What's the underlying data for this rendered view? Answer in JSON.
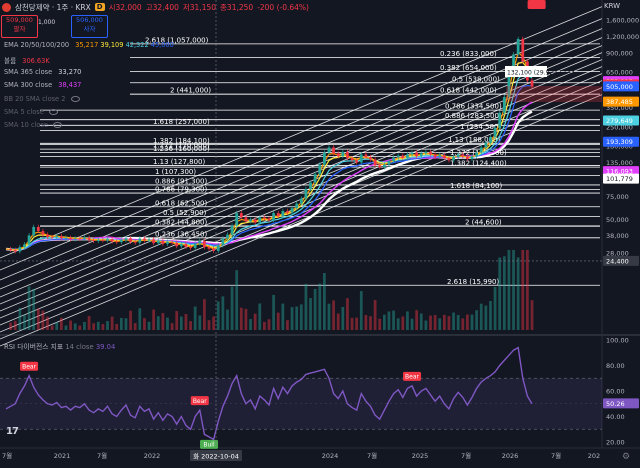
{
  "header": {
    "title": "삼천당제약 · 1주 · KRX",
    "badge": "D",
    "open": "시32,000",
    "high": "고32,400",
    "low": "저31,150",
    "close": "종31,250",
    "change": "-200 (-0.64%)",
    "currency": "KRW"
  },
  "order": {
    "sell_price": "509,000",
    "sell_label": "팔자",
    "quantity": "1,000",
    "buy_price": "506,000",
    "buy_label": "사자"
  },
  "indicators": [
    {
      "name": "EMA 20/50/100/200",
      "values": [
        "35,217",
        "39,109",
        "42,322",
        "45,000"
      ],
      "colors": [
        "#ff9800",
        "#ffeb3b",
        "#4dd0e1",
        "#2962ff"
      ]
    },
    {
      "name": "볼륨",
      "values": [
        "306.63K"
      ],
      "colors": [
        "#f23645"
      ]
    },
    {
      "name": "SMA 365 close",
      "values": [
        "33,270"
      ],
      "colors": [
        "#d1d4dc"
      ]
    },
    {
      "name": "SMA 300 close",
      "values": [
        "38,437"
      ],
      "colors": [
        "#e040fb"
      ]
    },
    {
      "name": "BB 20 SMA close 2",
      "values": [],
      "colors": []
    },
    {
      "name": "SMA 5 close",
      "values": [],
      "colors": []
    },
    {
      "name": "SMA 10 close",
      "values": [],
      "colors": []
    }
  ],
  "rsi": {
    "title": "RSI 다이버전스 지표",
    "params": "14 close",
    "value": "39.04",
    "current": "50.26"
  },
  "measure": "132,100 (29.92%) 133",
  "colors": {
    "background": "#131722",
    "up": "#26a69a",
    "down": "#f23645",
    "fib": "#ffffff",
    "ema20": "#ff9800",
    "ema50": "#ffeb3b",
    "ema100": "#4dd0e1",
    "ema200": "#2962ff",
    "sma300": "#e040fb",
    "sma365": "#ffffff",
    "rsi": "#7e57c2",
    "bear": "#f23645",
    "bull": "#4caf50"
  },
  "icons": {
    "settings": "gear-icon",
    "logo": "tradingview-logo-icon",
    "visibility": "eye-icon"
  },
  "chart_data": {
    "type": "candlestick",
    "yscale": "log",
    "price_axis_labels": [
      "1,600,000",
      "1,200,000",
      "900,000",
      "650,000",
      "500,000",
      "350,000",
      "250,000",
      "180,000",
      "135,000",
      "100,000",
      "75,000",
      "50,000",
      "38,000",
      "28,000"
    ],
    "price_badges": [
      {
        "label": "553,915",
        "value": 553915,
        "color": "#e040fb"
      },
      {
        "label": "523,495",
        "value": 523495,
        "color": "#f23645"
      },
      {
        "label": "505,000",
        "value": 505000,
        "color": "#2962ff"
      },
      {
        "label": "387,485",
        "value": 387485,
        "color": "#ff9800"
      },
      {
        "label": "279,649",
        "value": 279649,
        "color": "#4dd0e1"
      },
      {
        "label": "193,309",
        "value": 193309,
        "color": "#2962ff"
      },
      {
        "label": "116,093",
        "value": 116093,
        "color": "#e040fb"
      },
      {
        "label": "101,779",
        "value": 101779,
        "color": "#ffffff"
      },
      {
        "label": "24,400",
        "value": 24400,
        "color": "#363a45"
      }
    ],
    "fib_levels": [
      {
        "label": "2.618 (1,057,000)",
        "value": 1057000
      },
      {
        "label": "0.236 (833,000)",
        "value": 833000
      },
      {
        "label": "0.382 (654,000)",
        "value": 654000
      },
      {
        "label": "0.5 (538,000)",
        "value": 538000
      },
      {
        "label": "2 (441,000)",
        "value": 441000
      },
      {
        "label": "0.618 (442,000)",
        "value": 442000
      },
      {
        "label": "0.786 (334,500)",
        "value": 334500
      },
      {
        "label": "0.886 (283,500)",
        "value": 283500
      },
      {
        "label": "1.618 (257,000)",
        "value": 257000
      },
      {
        "label": "1 (234,500)",
        "value": 234500
      },
      {
        "label": "1.13 (188,000)",
        "value": 188000
      },
      {
        "label": "1.382 (184,100)",
        "value": 184100
      },
      {
        "label": "1.272 (170,000)",
        "value": 170000
      },
      {
        "label": "1.236 (160,000)",
        "value": 160000
      },
      {
        "label": "1.272 (149,300)",
        "value": 149300
      },
      {
        "label": "1.13 (127,800)",
        "value": 127800
      },
      {
        "label": "1.382 (124,400)",
        "value": 124400
      },
      {
        "label": "1 (107,300)",
        "value": 107300
      },
      {
        "label": "0.886 (91,300)",
        "value": 91300
      },
      {
        "label": "1.618 (84,100)",
        "value": 84100
      },
      {
        "label": "0.786 (79,300)",
        "value": 79300
      },
      {
        "label": "0.618 (62,500)",
        "value": 62500
      },
      {
        "label": "0.5 (52,900)",
        "value": 52900
      },
      {
        "label": "0.382 (44,800)",
        "value": 44800
      },
      {
        "label": "2 (44,600)",
        "value": 44600
      },
      {
        "label": "0.236 (36,450)",
        "value": 36450
      },
      {
        "label": "2.618 (15,990)",
        "value": 15990
      }
    ],
    "x_labels": [
      "7월",
      "2021",
      "7월",
      "2022",
      "7월",
      "2024",
      "7월",
      "2025",
      "7월",
      "2026",
      "7월",
      "202"
    ],
    "cursor_date": "화 2022-10-04",
    "rsi_axis_labels": [
      "100.00",
      "80.00",
      "60.00",
      "40.00",
      "20.00"
    ],
    "rsi_range": [
      20,
      100
    ],
    "rsi_signals": [
      {
        "label": "Bear",
        "kind": "bear",
        "index": 5
      },
      {
        "label": "Bear",
        "kind": "bear",
        "index": 42
      },
      {
        "label": "Bull",
        "kind": "bull",
        "index": 44
      },
      {
        "label": "Bear",
        "kind": "bear",
        "index": 88
      },
      {
        "label": "Bear",
        "kind": "bear",
        "index": 115
      }
    ],
    "price_series": [
      30000,
      29500,
      28800,
      31000,
      32500,
      38000,
      44000,
      41000,
      38500,
      37000,
      36800,
      37500,
      36200,
      36400,
      35500,
      36000,
      35800,
      36500,
      35000,
      34500,
      35200,
      34800,
      35600,
      34200,
      33800,
      35000,
      36200,
      34000,
      33500,
      36000,
      34800,
      35500,
      33200,
      34600,
      32800,
      34000,
      33500,
      31500,
      32800,
      31200,
      30500,
      33000,
      34500,
      31000,
      30200,
      29000,
      32000,
      36000,
      38500,
      45000,
      56000,
      52000,
      48500,
      50000,
      47500,
      52000,
      51000,
      49500,
      56000,
      53000,
      58000,
      56500,
      61000,
      66000,
      72000,
      85000,
      95000,
      110000,
      130000,
      160000,
      175000,
      158000,
      150000,
      162000,
      145000,
      140000,
      135000,
      155000,
      148000,
      142000,
      128000,
      124000,
      130000,
      138000,
      147000,
      152000,
      146000,
      155000,
      160000,
      150000,
      158000,
      162000,
      155000,
      148000,
      153000,
      146000,
      140000,
      148000,
      155000,
      150000,
      143000,
      150000,
      160000,
      175000,
      190000,
      210000,
      245000,
      320000,
      420000,
      600000,
      880000,
      1150000,
      780000,
      560000,
      505000
    ],
    "rsi_series": [
      46,
      48,
      50,
      58,
      64,
      72,
      63,
      57,
      53,
      50,
      49,
      51,
      47,
      48,
      45,
      48,
      47,
      50,
      45,
      43,
      46,
      44,
      48,
      42,
      40,
      45,
      49,
      41,
      39,
      48,
      44,
      46,
      38,
      43,
      37,
      42,
      40,
      34,
      40,
      33,
      30,
      40,
      45,
      26,
      24,
      22,
      36,
      48,
      56,
      66,
      72,
      58,
      50,
      53,
      46,
      56,
      53,
      49,
      62,
      54,
      63,
      58,
      64,
      67,
      69,
      73,
      74,
      75,
      76,
      77,
      70,
      58,
      54,
      60,
      50,
      47,
      45,
      58,
      52,
      48,
      41,
      38,
      45,
      52,
      58,
      61,
      55,
      62,
      64,
      56,
      60,
      62,
      57,
      52,
      56,
      50,
      46,
      54,
      59,
      55,
      49,
      55,
      62,
      67,
      70,
      72,
      75,
      80,
      84,
      88,
      92,
      94,
      70,
      56,
      50
    ]
  }
}
